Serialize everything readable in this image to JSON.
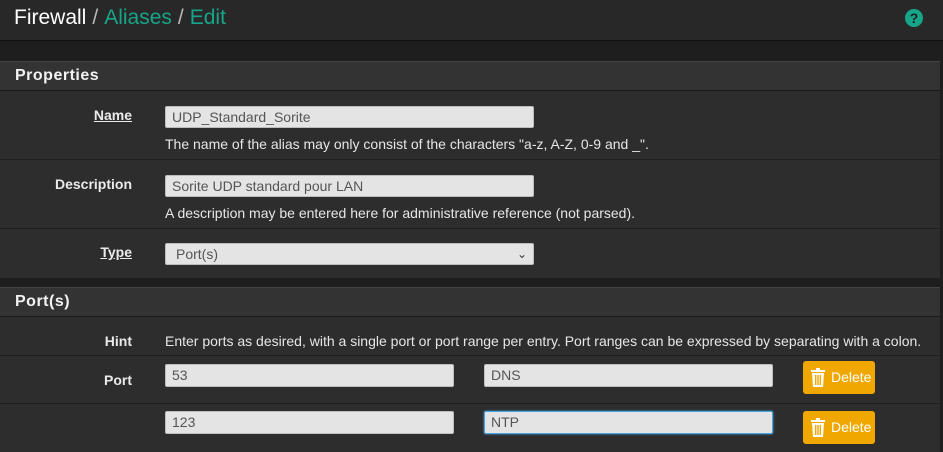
{
  "header": {
    "breadcrumb": {
      "root": "Firewall",
      "sep1": "/",
      "aliases": "Aliases",
      "sep2": "/",
      "edit": "Edit"
    },
    "help_icon": "?"
  },
  "properties": {
    "title": "Properties",
    "name": {
      "label": "Name",
      "value": "UDP_Standard_Sorite",
      "help": "The name of the alias may only consist of the characters \"a-z, A-Z, 0-9 and _\"."
    },
    "description": {
      "label": "Description",
      "value": "Sorite UDP standard pour LAN",
      "help": "A description may be entered here for administrative reference (not parsed)."
    },
    "type": {
      "label": "Type",
      "value": "Port(s)",
      "caret": "⌄"
    }
  },
  "ports": {
    "title": "Port(s)",
    "hint_label": "Hint",
    "hint_text": "Enter ports as desired, with a single port or port range per entry. Port ranges can be expressed by separating with a colon.",
    "port_label": "Port",
    "entries": [
      {
        "port": "53",
        "description": "DNS",
        "delete_label": "Delete"
      },
      {
        "port": "123",
        "description": "NTP",
        "delete_label": "Delete"
      }
    ]
  },
  "colors": {
    "accent": "#17a589",
    "delete": "#f0a800",
    "background": "#1e1e1e",
    "panel": "#2d2d2d"
  }
}
